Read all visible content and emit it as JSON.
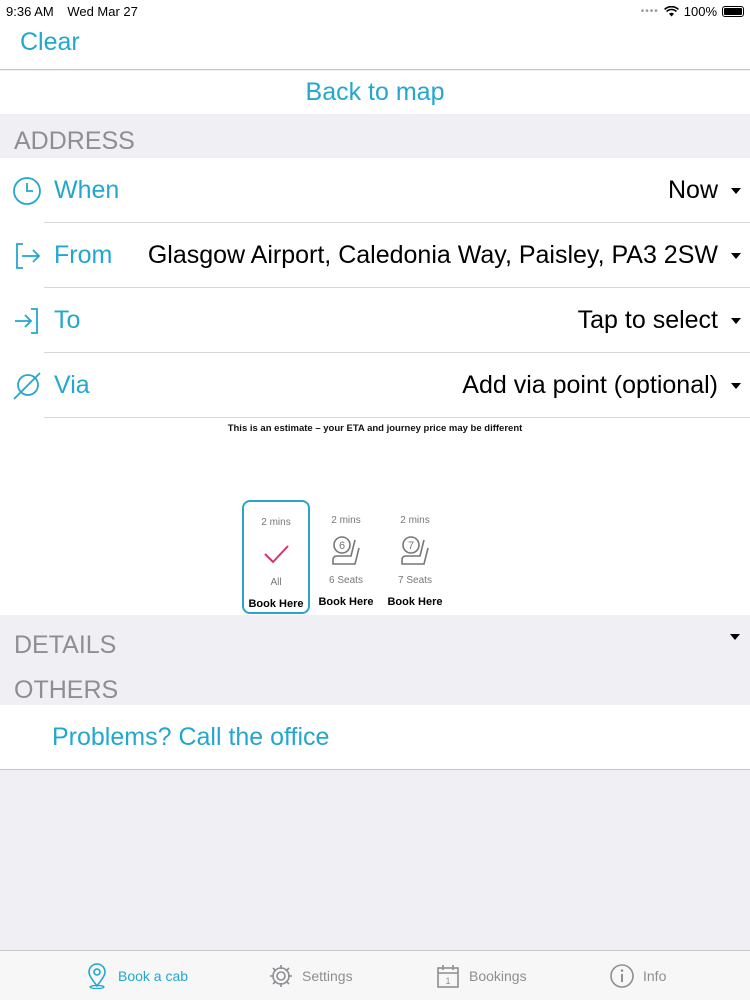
{
  "status_bar": {
    "time": "9:36 AM",
    "date": "Wed Mar 27",
    "battery": "100%"
  },
  "nav": {
    "clear_label": "Clear"
  },
  "back_to_map_label": "Back to map",
  "sections": {
    "address": "ADDRESS",
    "details": "DETAILS",
    "others": "OTHERS"
  },
  "address": {
    "when": {
      "label": "When",
      "value": "Now",
      "icon": "clock-icon"
    },
    "from": {
      "label": "From",
      "value": "Glasgow Airport, Caledonia Way, Paisley, PA3 2SW",
      "icon": "pickup-arrow-icon"
    },
    "to": {
      "label": "To",
      "value": "Tap to select",
      "icon": "dropoff-arrow-icon"
    },
    "via": {
      "label": "Via",
      "value": "Add via point (optional)",
      "icon": "via-point-icon"
    }
  },
  "estimate_notice": "This is an estimate – your ETA and journey price may be different",
  "vehicles": [
    {
      "eta": "2 mins",
      "name": "All",
      "book_label": "Book Here",
      "icon": "checkmark-icon",
      "selected": true
    },
    {
      "eta": "2 mins",
      "name": "6 Seats",
      "book_label": "Book Here",
      "icon": "seat-6-icon",
      "seat_number": "6",
      "selected": false
    },
    {
      "eta": "2 mins",
      "name": "7 Seats",
      "book_label": "Book Here",
      "icon": "seat-7-icon",
      "seat_number": "7",
      "selected": false
    }
  ],
  "problems_label": "Problems? Call the office",
  "tabs": [
    {
      "label": "Book a cab",
      "icon": "map-pin-icon",
      "active": true
    },
    {
      "label": "Settings",
      "icon": "gear-icon",
      "active": false
    },
    {
      "label": "Bookings",
      "icon": "calendar-icon",
      "calendar_day": "1",
      "active": false
    },
    {
      "label": "Info",
      "icon": "info-icon",
      "active": false
    }
  ],
  "colors": {
    "accent": "#23a7cf",
    "section_header": "#8e8e93",
    "check": "#d6336c",
    "background": "#efeff4"
  }
}
